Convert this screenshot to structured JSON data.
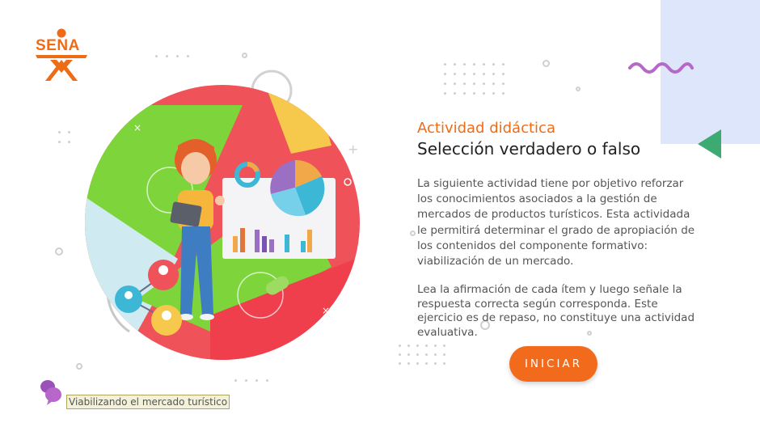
{
  "logo": {
    "text": "SENA"
  },
  "activity": {
    "kicker": "Actividad didáctica",
    "title": "Selección verdadero o falso",
    "paragraph1": "La siguiente actividad tiene por objetivo reforzar los conocimientos asociados a la gestión de mercados de productos turísticos.  Esta actividada le permitirá determinar el grado de apropiación de los contenidos del componente formativo: viabilización de un mercado.",
    "paragraph2": "Lea la afirmación de cada ítem y luego señale la respuesta correcta según corresponda.  Este ejercicio es de repaso, no constituye una actividad evaluativa.",
    "start_label": "INICIAR"
  },
  "footer": {
    "label": "Viabilizando el mercado turístico"
  },
  "colors": {
    "accent": "#ef6c17",
    "button": "#f26a1b",
    "blue_panel": "#dde6fb",
    "red_circle": "#f0525a",
    "green": "#7ed43b",
    "purple_wave": "#b667c9",
    "teal_triangle": "#3daa72"
  },
  "icons": {
    "logo": "sena-logo",
    "wave": "zigzag-wave-decoration",
    "triangle": "green-triangle-decoration",
    "chat": "chat-bubbles-icon"
  }
}
